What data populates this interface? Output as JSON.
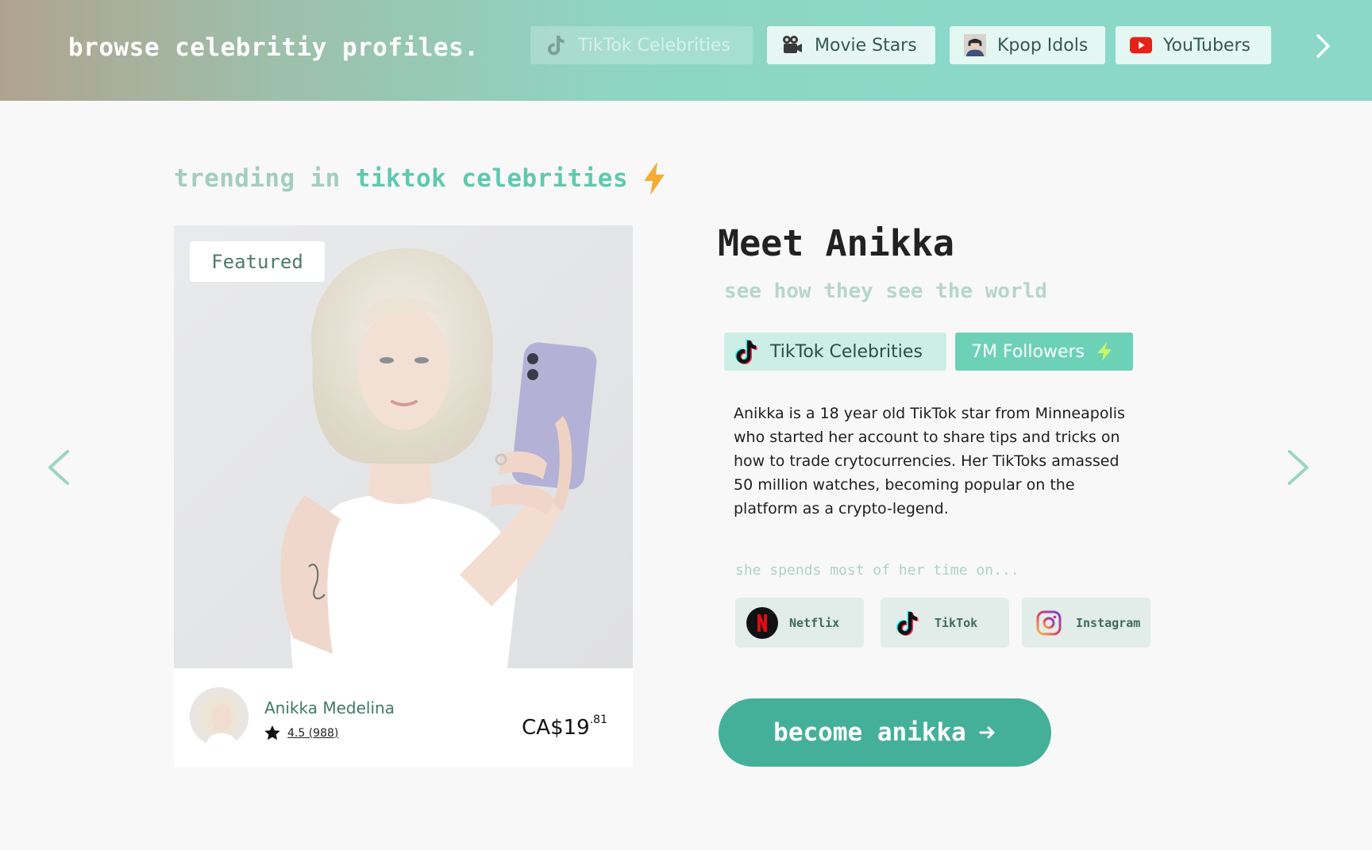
{
  "header": {
    "brand": "browse celebritiy profiles.",
    "categories": [
      {
        "label": "TikTok Celebrities",
        "icon": "tiktok-icon",
        "active": false
      },
      {
        "label": "Movie Stars",
        "icon": "movie-camera-icon"
      },
      {
        "label": "Kpop Idols",
        "icon": "kpop-idol-avatar-icon"
      },
      {
        "label": "YouTubers",
        "icon": "youtube-icon"
      }
    ],
    "next_icon": "chevron-right-icon"
  },
  "section": {
    "prefix": "trending in",
    "highlight": "tiktok celebrities",
    "icon": "lightning-icon"
  },
  "card": {
    "badge": "Featured",
    "name": "Anikka Medelina",
    "rating": "4.5 (988)",
    "price_main": "CA$19",
    "price_cents": ".81"
  },
  "profile": {
    "title": "Meet Anikka",
    "tagline": "see how they see the world",
    "category_chip": "TikTok Celebrities",
    "followers_chip": "7M Followers",
    "bio": "Anikka is a 18 year old TikTok star from Minneapolis who started her account to share tips and tricks on how to trade crytocurrencies. Her TikToks amassed 50 million watches, becoming popular on the platform as a crypto-legend.",
    "spends_label": "she spends most of her time on...",
    "platforms": [
      {
        "label": "Netflix",
        "icon": "netflix-icon"
      },
      {
        "label": "TikTok",
        "icon": "tiktok-icon"
      },
      {
        "label": "Instagram",
        "icon": "instagram-icon"
      }
    ],
    "cta": "become anikka",
    "cta_icon": "arrow-right-icon"
  },
  "colors": {
    "accent": "#45b09a",
    "mint": "#6cd1b6",
    "chip_bg": "#cdeee5",
    "lightning": "#f5ac32"
  }
}
